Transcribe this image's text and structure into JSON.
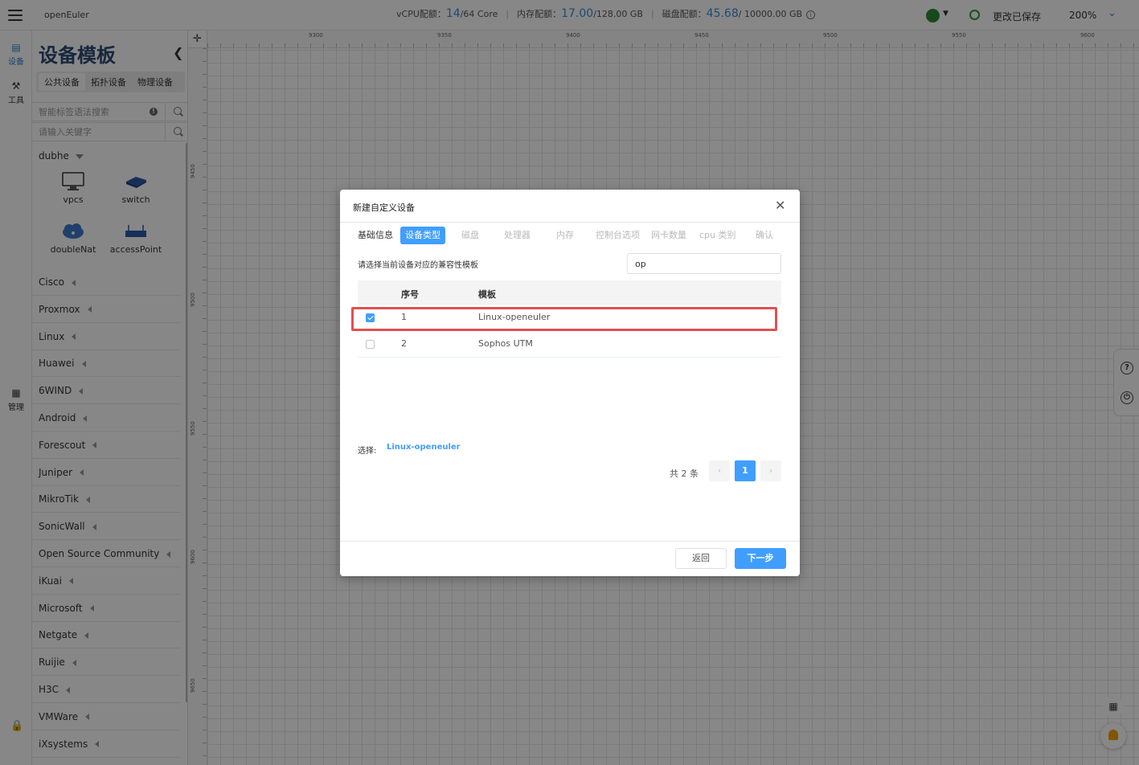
{
  "header": {
    "app_name": "openEuler",
    "vcpu_label": "vCPU配额：",
    "vcpu_used": "14",
    "vcpu_total": "/64 Core",
    "mem_label": "内存配额：",
    "mem_used": "17.00",
    "mem_total": "/128.00 GB",
    "disk_label": "磁盘配额：",
    "disk_used": "45.68",
    "disk_total": " / 10000.00 GB",
    "info_icon": "ⓘ",
    "saved_text": "更改已保存",
    "zoom": "200%"
  },
  "rail": {
    "devices": "设备",
    "tools": "工具",
    "manage": "管理"
  },
  "panel": {
    "title": "设备模板",
    "tabs": [
      "公共设备",
      "拓扑设备",
      "物理设备"
    ],
    "smart_search_placeholder": "智能标签语法搜索",
    "keyword_placeholder": "请输入关键字",
    "open_group": "dubhe",
    "devices": [
      "vpcs",
      "switch",
      "doubleNat",
      "accessPoint"
    ],
    "categories": [
      "Cisco",
      "Proxmox",
      "Linux",
      "Huawei",
      "6WIND",
      "Android",
      "Forescout",
      "Juniper",
      "MikroTik",
      "SonicWall",
      "Open Source Community",
      "iKuai",
      "Microsoft",
      "Netgate",
      "Ruijie",
      "H3C",
      "VMWare",
      "iXsystems"
    ]
  },
  "ruler": {
    "x_ticks": [
      "9300",
      "9350",
      "9400",
      "9450",
      "9500",
      "9550",
      "9600"
    ],
    "y_ticks": [
      "9450",
      "9500",
      "9550",
      "9600",
      "9650"
    ]
  },
  "dialog": {
    "title": "新建自定义设备",
    "steps": [
      "基础信息",
      "设备类型",
      "磁盘",
      "处理器",
      "内存",
      "控制台选项",
      "网卡数量",
      "cpu 类别",
      "确认"
    ],
    "hint": "请选择当前设备对应的兼容性模板",
    "filter_value": "op",
    "col_no": "序号",
    "col_template": "模板",
    "rows": [
      {
        "no": "1",
        "name": "Linux-openeuler",
        "checked": true
      },
      {
        "no": "2",
        "name": "Sophos UTM",
        "checked": false
      }
    ],
    "chosen_label": "选择:",
    "chosen_value": "Linux-openeuler",
    "total_text": "共 2 条",
    "current_page": "1",
    "back_label": "返回",
    "next_label": "下一步"
  },
  "colors": {
    "accent": "#409eff",
    "highlight": "#e05050",
    "title": "#2c4a78"
  }
}
